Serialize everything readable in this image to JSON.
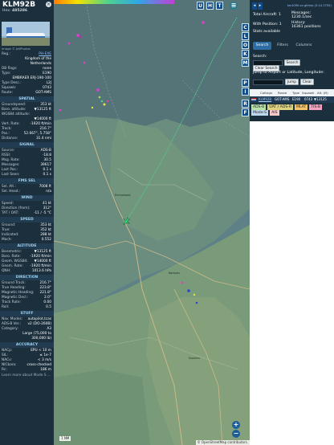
{
  "aircraft": {
    "callsign": "KLM92B",
    "hex_label": "Hex:",
    "hex": "485286",
    "close_label": "×",
    "photo_credit": "image © JetPhotos"
  },
  "details": [
    {
      "k": "Reg.:",
      "v": "PH-EXE",
      "link": true
    },
    {
      "k": "",
      "v": "Kingdom of the"
    },
    {
      "k": "",
      "v": "Netherlands"
    },
    {
      "k": "DB flags:",
      "v": "none"
    },
    {
      "k": "Type:",
      "v": "E190"
    },
    {
      "k": "",
      "v": "EMBRAER ERJ-190-100"
    },
    {
      "k": "Type Desc.:",
      "v": "L2J"
    },
    {
      "k": "Squawk:",
      "v": "0743"
    },
    {
      "k": "Route:",
      "v": "GOT-AMS"
    }
  ],
  "sections": {
    "spatial": "SPATIAL",
    "signal": "SIGNAL",
    "fms": "FMS SEL",
    "wind": "WIND",
    "speed": "SPEED",
    "altitude": "ALTITUDE",
    "direction": "DIRECTION",
    "stuff": "STUFF",
    "accuracy": "ACCURACY"
  },
  "spatial": [
    {
      "k": "Groundspeed:",
      "v": "353 kt"
    },
    {
      "k": "Baro. altitude:",
      "v": "▼13125 ft"
    },
    {
      "k": "WGS84 altitude:",
      "v": ""
    },
    {
      "k": "",
      "v": "▼14000 ft"
    },
    {
      "k": "Vert. Rate:",
      "v": "-1920 ft/min"
    },
    {
      "k": "Track:",
      "v": "216.7°"
    },
    {
      "k": "Pos.:",
      "v": "52.667°, 5.758°"
    },
    {
      "k": "Distance:",
      "v": "31.4 nmi"
    }
  ],
  "signal": [
    {
      "k": "Source:",
      "v": "ADS-B"
    },
    {
      "k": "RSSI:",
      "v": "-18.8"
    },
    {
      "k": "Msg. Rate:",
      "v": "30.5"
    },
    {
      "k": "Messages:",
      "v": "39617"
    },
    {
      "k": "Last Pos.:",
      "v": "0.1 s"
    },
    {
      "k": "Last Seen:",
      "v": "0.1 s"
    }
  ],
  "fms": [
    {
      "k": "Sel. Alt.:",
      "v": "7008 ft"
    },
    {
      "k": "Sel. Head.:",
      "v": "n/a"
    }
  ],
  "wind": [
    {
      "k": "Speed:",
      "v": "41 kt"
    },
    {
      "k": "Direction (from):",
      "v": "312°"
    },
    {
      "k": "TAT / OAT:",
      "v": "-11 / -5 °C"
    }
  ],
  "speed": [
    {
      "k": "Ground:",
      "v": "353 kt"
    },
    {
      "k": "True:",
      "v": "352 kt"
    },
    {
      "k": "Indicated:",
      "v": "288 kt"
    },
    {
      "k": "Mach:",
      "v": "0.552"
    }
  ],
  "altitude": [
    {
      "k": "Barometric:",
      "v": "▼13125 ft"
    },
    {
      "k": "Baro. Rate:",
      "v": "-1920 ft/min"
    },
    {
      "k": "Geom. WGS84:",
      "v": "▼14000 ft"
    },
    {
      "k": "Geom. Rate:",
      "v": "-1920 ft/min"
    },
    {
      "k": "QNH:",
      "v": "1013.6 hPa"
    }
  ],
  "direction": [
    {
      "k": "Ground Track:",
      "v": "216.7°"
    },
    {
      "k": "True Heading:",
      "v": "223.8°"
    },
    {
      "k": "Magnetic Heading:",
      "v": "221.8°"
    },
    {
      "k": "Magnetic Decl.:",
      "v": "2.0°"
    },
    {
      "k": "Track Rate:",
      "v": "0.00"
    },
    {
      "k": "Roll:",
      "v": "0.5"
    }
  ],
  "stuff": [
    {
      "k": "Nav. Modes:",
      "v": "autopilot,tcas"
    },
    {
      "k": "ADS-B Ver.:",
      "v": "v2 (DO-260B)"
    },
    {
      "k": "Category:",
      "v": "A3"
    },
    {
      "k": "",
      "v": "Large (75,000 to"
    },
    {
      "k": "",
      "v": "300,000 lb)"
    }
  ],
  "accuracy": [
    {
      "k": "NACp:",
      "v": "EPU < 10 m"
    },
    {
      "k": "SIL:",
      "v": "≤ 1e-7"
    },
    {
      "k": "NACv:",
      "v": "< 3 m/s"
    },
    {
      "k": "NICbaro:",
      "v": "cross-checked"
    },
    {
      "k": "Rc:",
      "v": "186 m"
    }
  ],
  "footer_note": "Learn more about Mode S ...",
  "map": {
    "top_buttons": [
      "U",
      "H",
      "T"
    ],
    "side_buttons": [
      "C",
      "L",
      "O",
      "K",
      "M",
      "P",
      "I",
      "R",
      "F"
    ],
    "zoom_in": "+",
    "zoom_out": "−",
    "scale": "1 NM",
    "attribution": "© OpenStreetMap contributors.",
    "labels": [
      "Kampen",
      "Emmeloord",
      "Dronten"
    ]
  },
  "sidebar": {
    "github_link": "tar1090 on github (3.14.1755)",
    "total_aircraft_label": "Total Aircraft:",
    "total_aircraft": "1",
    "with_position_label": "With Position:",
    "with_position": "1",
    "stats_label": "Stats available",
    "messages_label": "Messages:",
    "messages": "1230.1/sec",
    "history_label": "History:",
    "history": "16361 positions",
    "tabs": [
      "Search",
      "Filters",
      "Columns"
    ],
    "search_label": "Search:",
    "search_button": "Search",
    "clear_search_button": "Clear Search",
    "jump_label": "Jump to Airport or Latitude, Longitude:",
    "jump_button": "Jump",
    "clear_button": "Clear",
    "table_headers": [
      "Callsign",
      "Route",
      "Type",
      "Squawk",
      "Alt. (ft)"
    ],
    "row": {
      "callsign": "KLM92B",
      "route": "GOT-AMS",
      "type": "E190",
      "squawk": "0743",
      "alt": "▼13125"
    },
    "legend": [
      {
        "label": "ADS-B",
        "color": "#b7e3a8"
      },
      {
        "label": "UAT / ADS-R",
        "color": "#ddd27d"
      },
      {
        "label": "MLAT",
        "color": "#f4c46b"
      },
      {
        "label": "TIS-B",
        "color": "#f4a3bf"
      },
      {
        "label": "Mode-S",
        "color": "#bfd6ef"
      },
      {
        "label": "AIS",
        "color": "#f8c7c7"
      }
    ]
  },
  "colors": {
    "panel_bg": "#1b2f3d",
    "accent": "#2e6da4",
    "map_bg": "#5e8187"
  }
}
